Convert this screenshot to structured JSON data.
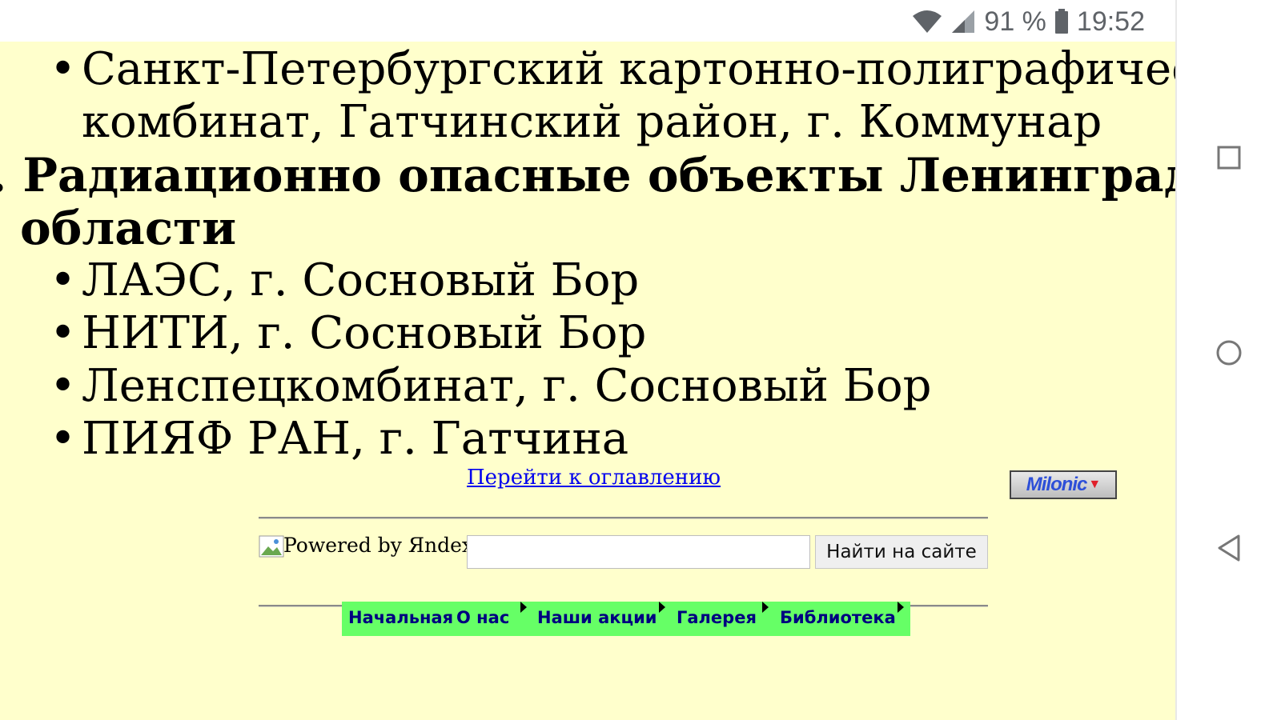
{
  "status_bar": {
    "battery_percent": "91 %",
    "time": "19:52",
    "icons": [
      "wifi-icon",
      "signal-icon",
      "battery-icon"
    ]
  },
  "page": {
    "prev_list": [
      {
        "line1": "Санкт-Петербургский картонно-полиграфическ",
        "line2": "комбинат, Гатчинский район, г. Коммунар"
      }
    ],
    "section_heading": {
      "line1": ". Радиационно опасные объекты Ленинградской",
      "line2": "области"
    },
    "items": [
      "ЛАЭС, г. Сосновый Бор",
      "НИТИ, г. Сосновый Бор",
      "Ленспецкомбинат, г. Сосновый Бор",
      "ПИЯФ РАН, г. Гатчина"
    ],
    "toc_link": "Перейти к оглавлению",
    "milonic_badge": "Milonic",
    "search": {
      "powered_by_alt": "Powered by Яndex",
      "input_value": "",
      "button_label": "Найти на сайте"
    },
    "menu": [
      "Начальная",
      "О нас",
      "Наши акции",
      "Галерея",
      "Библиотека"
    ]
  },
  "colors": {
    "page_bg": "#ffffcc",
    "menu_bg": "#66ff66",
    "menu_text": "#000080",
    "link": "#0000ee"
  }
}
